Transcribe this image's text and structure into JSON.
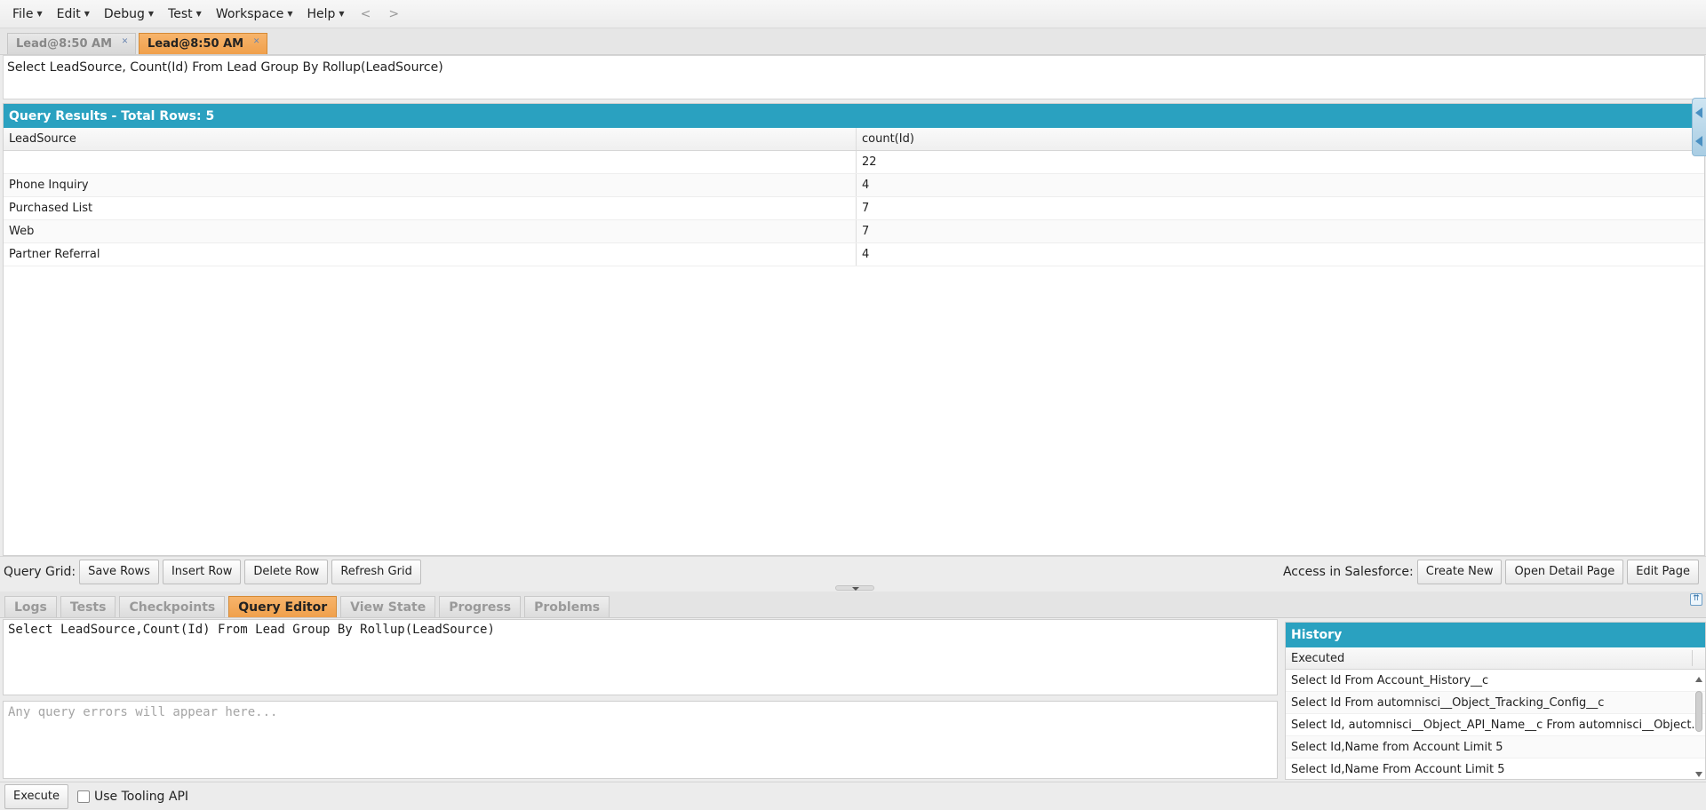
{
  "menu": {
    "items": [
      {
        "label": "File"
      },
      {
        "label": "Edit"
      },
      {
        "label": "Debug"
      },
      {
        "label": "Test"
      },
      {
        "label": "Workspace"
      },
      {
        "label": "Help"
      }
    ],
    "back": "<",
    "forward": ">"
  },
  "doc_tabs": [
    {
      "label": "Lead@8:50 AM",
      "active": false
    },
    {
      "label": "Lead@8:50 AM",
      "active": true
    }
  ],
  "query_display": "Select LeadSource, Count(Id) From Lead Group By Rollup(LeadSource)",
  "results": {
    "title": "Query Results - Total Rows: 5",
    "columns": [
      "LeadSource",
      "count(Id)"
    ],
    "rows": [
      [
        "",
        "22"
      ],
      [
        "Phone Inquiry",
        "4"
      ],
      [
        "Purchased List",
        "7"
      ],
      [
        "Web",
        "7"
      ],
      [
        "Partner Referral",
        "4"
      ]
    ]
  },
  "grid_toolbar": {
    "label": "Query Grid:",
    "save_rows": "Save Rows",
    "insert_row": "Insert Row",
    "delete_row": "Delete Row",
    "refresh_grid": "Refresh Grid",
    "salesforce_label": "Access in Salesforce:",
    "create_new": "Create New",
    "open_detail": "Open Detail Page",
    "edit_page": "Edit Page"
  },
  "panel_tabs": [
    {
      "label": "Logs",
      "active": false
    },
    {
      "label": "Tests",
      "active": false
    },
    {
      "label": "Checkpoints",
      "active": false
    },
    {
      "label": "Query Editor",
      "active": true
    },
    {
      "label": "View State",
      "active": false
    },
    {
      "label": "Progress",
      "active": false
    },
    {
      "label": "Problems",
      "active": false
    }
  ],
  "editor": {
    "value": "Select LeadSource,Count(Id) From Lead Group By Rollup(LeadSource)",
    "errors_placeholder": "Any query errors will appear here..."
  },
  "history": {
    "title": "History",
    "column": "Executed",
    "rows": [
      "Select Id From Account_History__c",
      "Select Id From automnisci__Object_Tracking_Config__c",
      "Select Id, automnisci__Object_API_Name__c From automnisci__Object...",
      "Select Id,Name from Account Limit 5",
      "Select Id,Name From Account Limit 5"
    ]
  },
  "footer": {
    "execute": "Execute",
    "tooling_label": "Use Tooling API",
    "tooling_checked": false
  },
  "colors": {
    "accent_blue": "#2aa1c0",
    "active_tab": "#f0a04c"
  }
}
